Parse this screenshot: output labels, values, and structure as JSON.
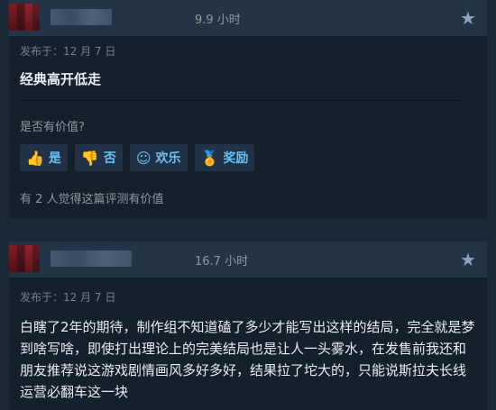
{
  "reviews": [
    {
      "hours": "9.9 小时",
      "posted": "发布于：12 月 7 日",
      "text": "经典高开低走",
      "helpful_question": "是否有价值?",
      "buttons": {
        "yes": "是",
        "no": "否",
        "funny": "欢乐",
        "award": "奖励"
      },
      "helpful_count": "有 2 人觉得这篇评测有价值"
    },
    {
      "hours": "16.7 小时",
      "posted": "发布于：12 月 7 日",
      "text": "白瞎了2年的期待，制作组不知道磕了多少才能写出这样的结局，完全就是梦到啥写啥，即使打出理论上的完美结局也是让人一头雾水，在发售前我还和朋友推荐说这游戏剧情画风多好多好，结果拉了坨大的，只能说斯拉夫长线运营必翻车这一块"
    }
  ]
}
